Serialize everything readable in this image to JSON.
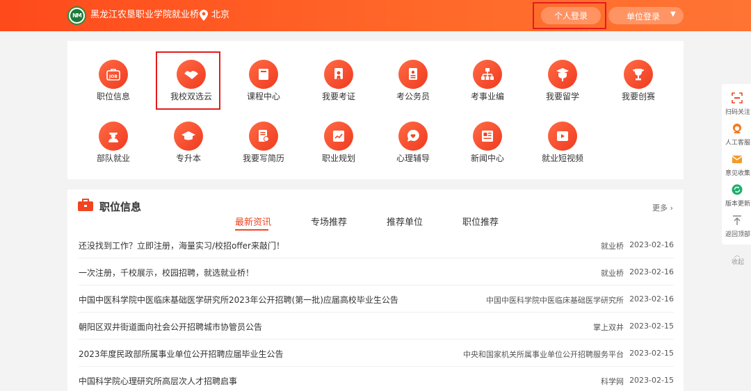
{
  "header": {
    "site_name": "黑龙江农垦职业学院就业桥",
    "logo_text": "NM",
    "city": "北京",
    "personal_login": "个人登录",
    "unit_login": "单位登录",
    "unit_caret": "▼"
  },
  "services": [
    {
      "label": "职位信息",
      "icon": "job-icon"
    },
    {
      "label": "我校双选云",
      "icon": "handshake-icon"
    },
    {
      "label": "课程中心",
      "icon": "book-icon"
    },
    {
      "label": "我要考证",
      "icon": "certificate-icon"
    },
    {
      "label": "考公务员",
      "icon": "civil-servant-icon"
    },
    {
      "label": "考事业编",
      "icon": "org-chart-icon"
    },
    {
      "label": "我要留学",
      "icon": "graduate-icon"
    },
    {
      "label": "我要创赛",
      "icon": "trophy-icon"
    },
    {
      "label": "部队就业",
      "icon": "soldier-icon"
    },
    {
      "label": "专升本",
      "icon": "mortarboard-icon"
    },
    {
      "label": "我要写简历",
      "icon": "resume-icon"
    },
    {
      "label": "职业规划",
      "icon": "chart-icon"
    },
    {
      "label": "心理辅导",
      "icon": "heart-chat-icon"
    },
    {
      "label": "新闻中心",
      "icon": "news-icon"
    },
    {
      "label": "就业短视频",
      "icon": "video-icon"
    }
  ],
  "jobs": {
    "title": "职位信息",
    "more": "更多",
    "tabs": [
      "最新资讯",
      "专场推荐",
      "推荐单位",
      "职位推荐"
    ],
    "rows": [
      {
        "title": "还没找到工作？立即注册，海量实习/校招offer来敲门！",
        "source": "就业桥",
        "date": "2023-02-16"
      },
      {
        "title": "一次注册，千校展示，校园招聘，就选就业桥！",
        "source": "就业桥",
        "date": "2023-02-16"
      },
      {
        "title": "中国中医科学院中医临床基础医学研究所2023年公开招聘(第一批)应届高校毕业生公告",
        "source": "中国中医科学院中医临床基础医学研究所",
        "date": "2023-02-16"
      },
      {
        "title": "朝阳区双井街道面向社会公开招聘城市协管员公告",
        "source": "掌上双井",
        "date": "2023-02-15"
      },
      {
        "title": "2023年度民政部所属事业单位公开招聘应届毕业生公告",
        "source": "中央和国家机关所属事业单位公开招聘服务平台",
        "date": "2023-02-15"
      },
      {
        "title": "中国科学院心理研究所高层次人才招聘启事",
        "source": "科学网",
        "date": "2023-02-15"
      }
    ]
  },
  "sidebar": {
    "items": [
      {
        "label": "扫码关注",
        "icon": "qr-scan-icon"
      },
      {
        "label": "人工客服",
        "icon": "customer-service-icon"
      },
      {
        "label": "意见收集",
        "icon": "feedback-icon"
      },
      {
        "label": "版本更新",
        "icon": "refresh-icon"
      },
      {
        "label": "返回顶部",
        "icon": "back-to-top-icon"
      }
    ],
    "collapse": "收起"
  },
  "colors": {
    "accent": "#f04520",
    "highlight": "#e31b1b"
  }
}
